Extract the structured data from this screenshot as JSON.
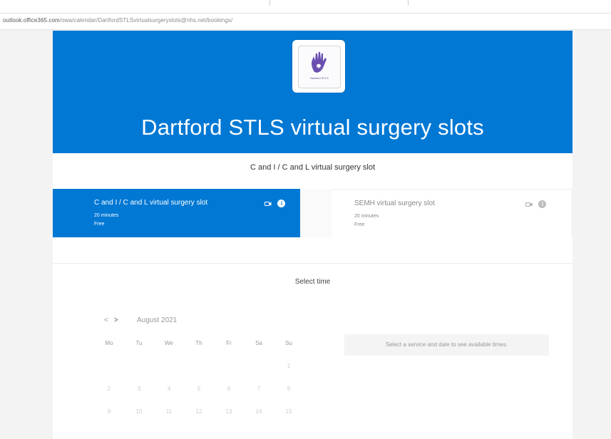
{
  "browser": {
    "url_host": "outlook.office365.com",
    "url_path": "/owa/calendar/DartfordSTLSvirtualsurgeryslots@nhs.net/bookings/"
  },
  "header": {
    "logo_caption": "Dartford STLS",
    "title": "Dartford STLS virtual surgery slots"
  },
  "services": {
    "heading": "C and I / C and L virtual surgery slot",
    "items": [
      {
        "name": "C and I / C and L virtual surgery slot",
        "duration": "20 minutes",
        "price": "Free",
        "selected": true
      },
      {
        "name": "SEMH virtual surgery slot",
        "duration": "20 minutes",
        "price": "Free",
        "selected": false
      }
    ],
    "video_icon": "video-camera-icon",
    "info_icon": "info-icon",
    "info_glyph": "i"
  },
  "time": {
    "heading": "Select time",
    "prev_glyph": "<",
    "next_glyph": ">",
    "month": "August 2021",
    "weekdays": [
      "Mo",
      "Tu",
      "We",
      "Th",
      "Fr",
      "Sa",
      "Su"
    ],
    "weeks": [
      [
        "",
        "",
        "",
        "",
        "",
        "",
        "1"
      ],
      [
        "2",
        "3",
        "4",
        "5",
        "6",
        "7",
        "8"
      ],
      [
        "9",
        "10",
        "11",
        "12",
        "13",
        "14",
        "15"
      ]
    ],
    "availability_message": "Select a service and date to see available times."
  },
  "colors": {
    "brand": "#0078d4",
    "background": "#f3f3f3"
  }
}
